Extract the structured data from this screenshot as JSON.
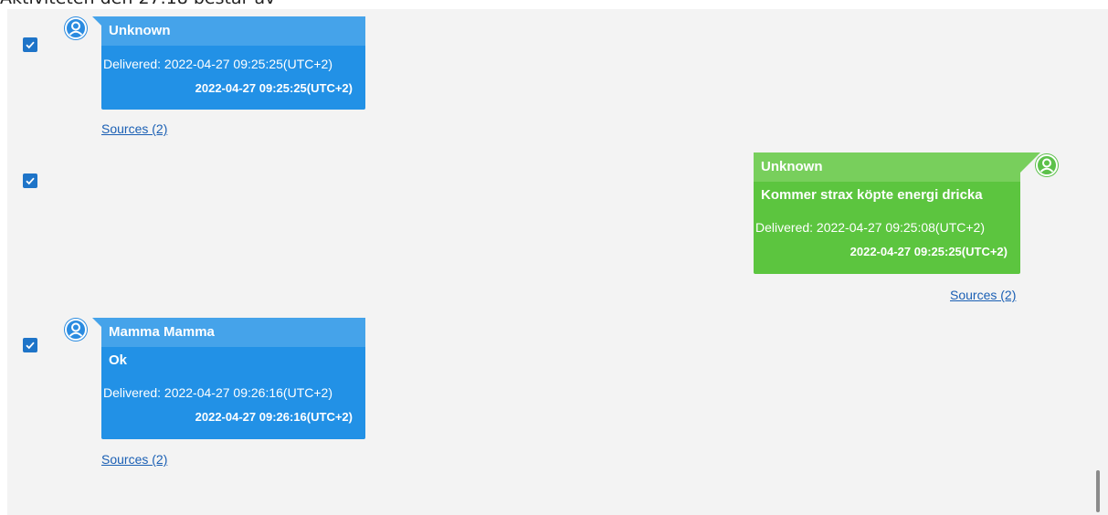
{
  "header": {
    "partial_text": "Aktiviteten den 27.18 bestar av"
  },
  "messages": [
    {
      "sender": "Unknown",
      "text": "",
      "delivered": "Delivered: 2022-04-27 09:25:25(UTC+2)",
      "timestamp": "2022-04-27 09:25:25(UTC+2)",
      "sources": "Sources (2)",
      "direction": "incoming",
      "checked": true
    },
    {
      "sender": "Unknown",
      "text": "Kommer strax köpte energi dricka",
      "delivered": "Delivered: 2022-04-27 09:25:08(UTC+2)",
      "timestamp": "2022-04-27 09:25:25(UTC+2)",
      "sources": "Sources (2)",
      "direction": "outgoing",
      "checked": true
    },
    {
      "sender": "Mamma Mamma",
      "text": "Ok",
      "delivered": "Delivered: 2022-04-27 09:26:16(UTC+2)",
      "timestamp": "2022-04-27 09:26:16(UTC+2)",
      "sources": "Sources (2)",
      "direction": "incoming",
      "checked": true
    }
  ],
  "colors": {
    "incoming_bubble": "#2291e6",
    "incoming_header": "#45a3ea",
    "outgoing_bubble": "#5cc53f",
    "outgoing_header": "#78cf5c",
    "checkbox": "#1e74c8",
    "link": "#1a5fb4"
  },
  "icons": {
    "avatar": "user-avatar-icon",
    "checkbox": "checkmark-icon"
  }
}
